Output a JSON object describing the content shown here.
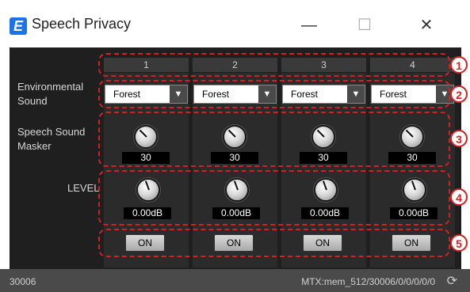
{
  "window": {
    "title": "Speech Privacy",
    "logo_letter": "E",
    "minimize_glyph": "—",
    "maximize_glyph": "☐",
    "close_glyph": "✕"
  },
  "columns": [
    {
      "header": "1",
      "sound": "Forest",
      "masker": "30",
      "level": "0.00dB",
      "on": "ON"
    },
    {
      "header": "2",
      "sound": "Forest",
      "masker": "30",
      "level": "0.00dB",
      "on": "ON"
    },
    {
      "header": "3",
      "sound": "Forest",
      "masker": "30",
      "level": "0.00dB",
      "on": "ON"
    },
    {
      "header": "4",
      "sound": "Forest",
      "masker": "30",
      "level": "0.00dB",
      "on": "ON"
    }
  ],
  "labels": {
    "env_sound_1": "Environmental",
    "env_sound_2": "Sound",
    "masker_1": "Speech Sound",
    "masker_2": "Masker",
    "level": "LEVEL"
  },
  "annotations": [
    "1",
    "2",
    "3",
    "4",
    "5"
  ],
  "status": {
    "left": "30006",
    "right": "MTX:mem_512/30006/0/0/0/0/0",
    "refresh_icon": "refresh-icon"
  },
  "colors": {
    "annotation": "#d42020",
    "panel": "#1f1f1f",
    "brand": "#1a73e8"
  }
}
